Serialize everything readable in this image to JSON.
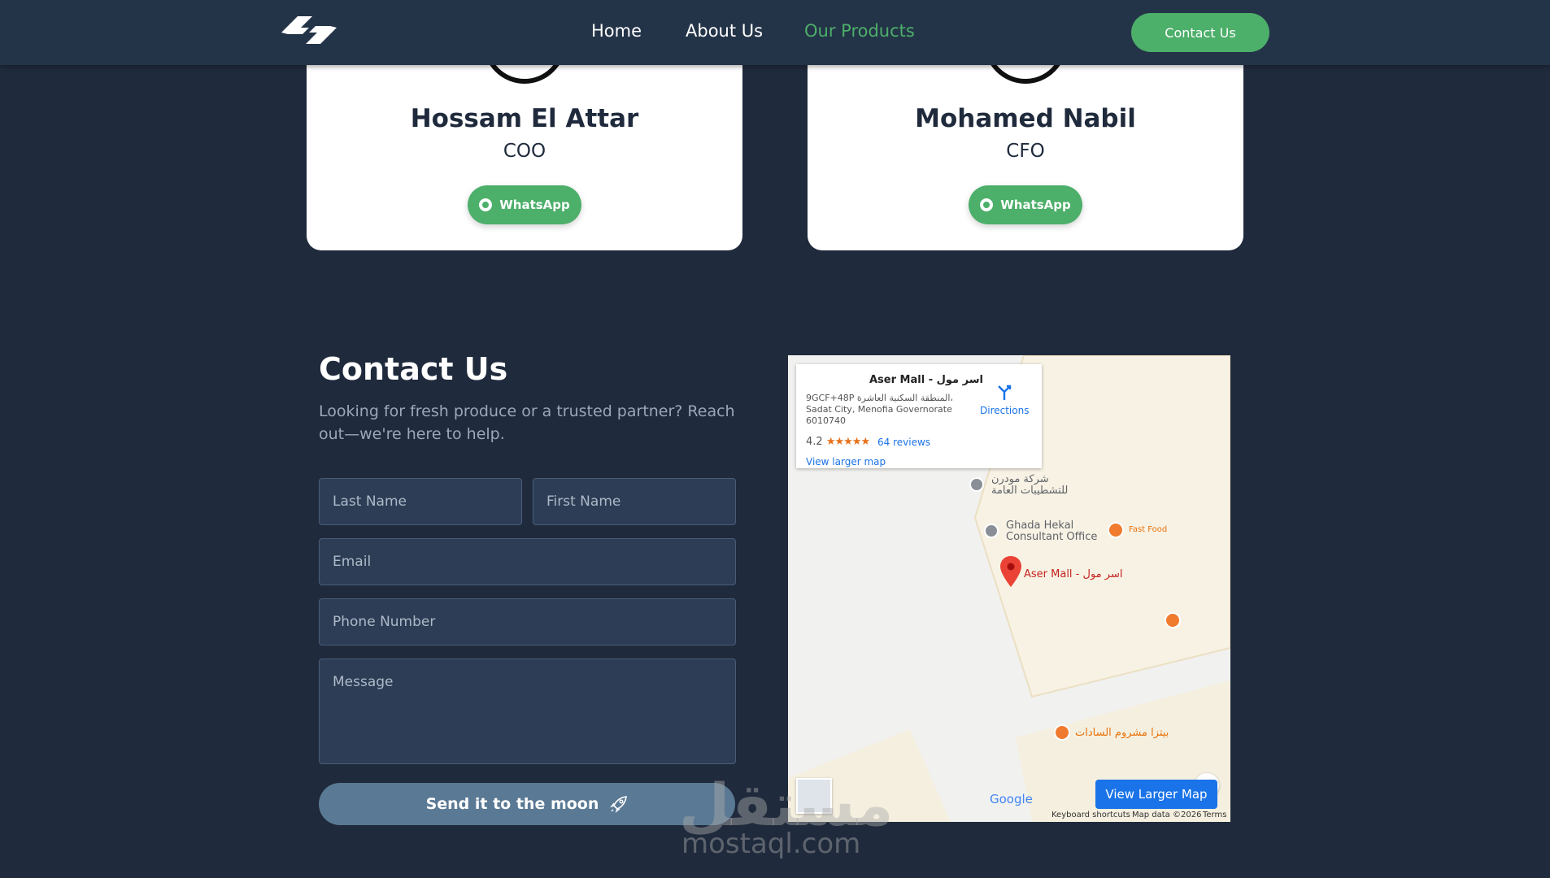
{
  "header": {
    "nav": [
      {
        "label": "Home",
        "active": false
      },
      {
        "label": "About Us",
        "active": false
      },
      {
        "label": "Our Products",
        "active": true
      }
    ],
    "contact_button": "Contact Us",
    "colors": {
      "accent": "#4caf6a",
      "bg": "#243448"
    }
  },
  "team": [
    {
      "name": "Hossam El Attar",
      "role": "COO",
      "button": "WhatsApp"
    },
    {
      "name": "Mohamed Nabil",
      "role": "CFO",
      "button": "WhatsApp"
    }
  ],
  "contact": {
    "title": "Contact Us",
    "subtitle": "Looking for fresh produce or a trusted partner? Reach out—we're here to help.",
    "fields": {
      "last_name": "Last Name",
      "first_name": "First Name",
      "email": "Email",
      "phone": "Phone Number",
      "message": "Message"
    },
    "submit": "Send it to the moon"
  },
  "map": {
    "place_title": "Aser Mall - اسر مول",
    "address": "9GCF+48P المنطقة السكنية العاشرة، Sadat City, Menofia Governorate 6010740",
    "rating": "4.2",
    "stars": "★★★★★",
    "reviews": "64 reviews",
    "view_larger_link": "View larger map",
    "directions": "Directions",
    "labels": {
      "modern": "شركة مودرن للتشطيبات العامة",
      "ghada": "Ghada Hekal Consultant Office",
      "fastfood": "Fast Food",
      "aser": "Aser Mall - اسر مول",
      "pizza": "بيتزا مشروم السادات"
    },
    "view_larger_button": "View Larger Map",
    "google": "Google",
    "footer": {
      "shortcuts": "Keyboard shortcuts",
      "mapdata": "Map data ©2026",
      "terms": "Terms"
    }
  },
  "watermark": {
    "arabic": "مستقل",
    "latin": "mostaql.com"
  }
}
